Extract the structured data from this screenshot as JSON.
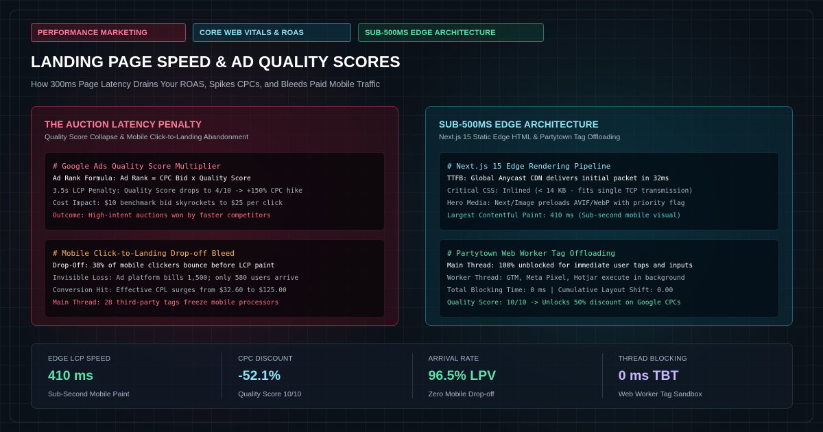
{
  "tags": [
    {
      "label": "PERFORMANCE MARKETING"
    },
    {
      "label": "CORE WEB VITALS & ROAS"
    },
    {
      "label": "SUB-500MS EDGE ARCHITECTURE"
    }
  ],
  "header": {
    "title": "LANDING PAGE SPEED & AD QUALITY SCORES",
    "subtitle": "How 300ms Page Latency Drains Your ROAS, Spikes CPCs, and Bleeds Paid Mobile Traffic"
  },
  "left_panel": {
    "title": "THE AUCTION LATENCY PENALTY",
    "subtitle": "Quality Score Collapse & Mobile Click-to-Landing Abandonment",
    "blocks": [
      {
        "heading": "# Google Ads Quality Score Multiplier",
        "lines": [
          "Ad Rank Formula: Ad Rank = CPC Bid x Quality Score",
          "3.5s LCP Penalty: Quality Score drops to 4/10 -> +150% CPC hike",
          "Cost Impact: $10 benchmark bid skyrockets to $25 per click",
          "Outcome: High-intent auctions won by faster competitors"
        ]
      },
      {
        "heading": "# Mobile Click-to-Landing Drop-off Bleed",
        "lines": [
          "Drop-Off: 38% of mobile clickers bounce before LCP paint",
          "Invisible Loss: Ad platform bills 1,500; only 580 users arrive",
          "Conversion Hit: Effective CPL surges from $32.60 to $125.00",
          "Main Thread: 28 third-party tags freeze mobile processors"
        ]
      }
    ]
  },
  "right_panel": {
    "title": "SUB-500MS EDGE ARCHITECTURE",
    "subtitle": "Next.js 15 Static Edge HTML & Partytown Tag Offloading",
    "blocks": [
      {
        "heading": "# Next.js 15 Edge Rendering Pipeline",
        "lines": [
          "TTFB: Global Anycast CDN delivers initial packet in 32ms",
          "Critical CSS: Inlined (< 14 KB - fits single TCP transmission)",
          "Hero Media: Next/Image preloads AVIF/WebP with priority flag",
          "Largest Contentful Paint: 410 ms (Sub-second mobile visual)"
        ]
      },
      {
        "heading": "# Partytown Web Worker Tag Offloading",
        "lines": [
          "Main Thread: 100% unblocked for immediate user taps and inputs",
          "Worker Thread: GTM, Meta Pixel, Hotjar execute in background",
          "Total Blocking Time: 0 ms | Cumulative Layout Shift: 0.00",
          "Quality Score: 10/10 -> Unlocks 50% discount on Google CPCs"
        ]
      }
    ]
  },
  "stats": [
    {
      "label": "EDGE LCP SPEED",
      "value": "410 ms",
      "note": "Sub-Second Mobile Paint",
      "color": "#5fe0a9"
    },
    {
      "label": "CPC DISCOUNT",
      "value": "-52.1%",
      "note": "Quality Score 10/10",
      "color": "#8fe2f5"
    },
    {
      "label": "ARRIVAL RATE",
      "value": "96.5% LPV",
      "note": "Zero Mobile Drop-off",
      "color": "#5fe0a9"
    },
    {
      "label": "THREAD BLOCKING",
      "value": "0 ms TBT",
      "note": "Web Worker Tag Sandbox",
      "color": "#c9b8ff"
    }
  ]
}
